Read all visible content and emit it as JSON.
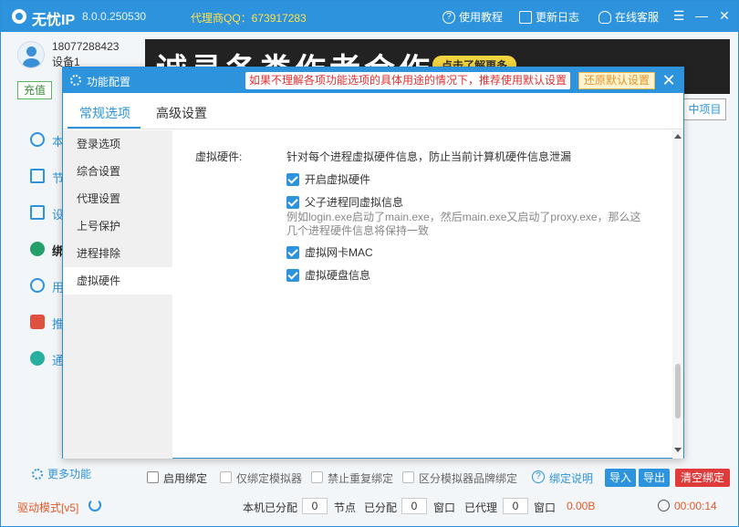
{
  "app": {
    "name": "无忧IP",
    "version": "8.0.0.250530",
    "agent_qq": "代理商QQ：673917283",
    "links": {
      "tutorial": "使用教程",
      "changelog": "更新日志",
      "support": "在线客服"
    }
  },
  "user": {
    "phone": "18077288423",
    "device": "设备1",
    "recharge": "充值"
  },
  "nav": [
    "本",
    "节",
    "设",
    "绑",
    "用",
    "推",
    "通"
  ],
  "more_functions": "更多功能",
  "banner": {
    "text": "诚寻各类作者合作",
    "pill": "点击了解更多"
  },
  "behind_tab": "中项目",
  "dialog": {
    "title": "功能配置",
    "tip": "如果不理解各项功能选项的具体用途的情况下，推荐使用默认设置",
    "reset": "还原默认设置",
    "tabs": {
      "general": "常规选项",
      "advanced": "高级设置"
    },
    "sidebar": [
      "登录选项",
      "综合设置",
      "代理设置",
      "上号保护",
      "进程排除",
      "虚拟硬件"
    ],
    "content": {
      "label": "虚拟硬件:",
      "description": "针对每个进程虚拟硬件信息，防止当前计算机硬件信息泄漏",
      "options": {
        "enable": "开启虚拟硬件",
        "parent_child": "父子进程同虚拟信息",
        "nic_mac": "虚拟网卡MAC",
        "disk": "虚拟硬盘信息"
      },
      "note": "例如login.exe启动了main.exe，然后main.exe又启动了proxy.exe，那么这几个进程硬件信息将保持一致"
    }
  },
  "bind_bar": {
    "enable_bind": "启用绑定",
    "emulator_only": "仅绑定模拟器",
    "no_duplicate": "禁止重复绑定",
    "brand_distinct": "区分模拟器品牌绑定",
    "help": "绑定说明",
    "import": "导入",
    "export": "导出",
    "clear": "清空绑定"
  },
  "status": {
    "driver_mode": "驱动模式[v5]",
    "local_allocated_label": "本机已分配",
    "local_allocated": "0",
    "node_label": "节点",
    "allocated_label": "已分配",
    "allocated": "0",
    "window_label1": "窗口",
    "proxied_label": "已代理",
    "proxied": "0",
    "window_label2": "窗口",
    "traffic": "0.00B",
    "timer": "00:00:14"
  },
  "colors": {
    "primary": "#2d93dd",
    "danger": "#e03b3b",
    "accent": "#e05a2a"
  }
}
